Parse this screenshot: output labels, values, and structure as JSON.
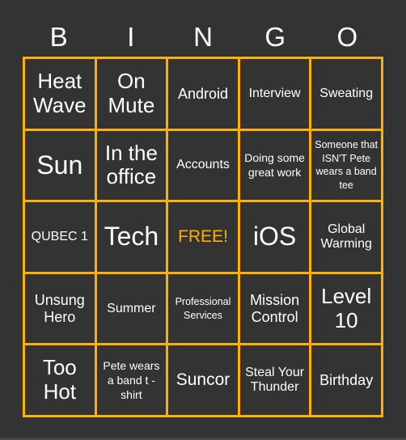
{
  "header": {
    "letters": [
      "B",
      "I",
      "N",
      "G",
      "O"
    ]
  },
  "colors": {
    "background": "#333333",
    "grid_lines": "#FFB000",
    "text": "#FFFFFF",
    "free_text": "#FFB000"
  },
  "board": {
    "rows": [
      [
        "Heat Wave",
        "On Mute",
        "Android",
        "Interview",
        "Sweating"
      ],
      [
        "Sun",
        "In the office",
        "Accounts",
        "Doing some great work",
        "Someone that ISN'T Pete wears a band tee"
      ],
      [
        "QUBEC 1",
        "Tech",
        "FREE!",
        "iOS",
        "Global Warming"
      ],
      [
        "Unsung Hero",
        "Summer",
        "Professional Services",
        "Mission Control",
        "Level 10"
      ],
      [
        "Too Hot",
        "Pete wears a band t - shirt",
        "Suncor",
        "Steal Your Thunder",
        "Birthday"
      ]
    ],
    "free_space": "FREE!"
  }
}
